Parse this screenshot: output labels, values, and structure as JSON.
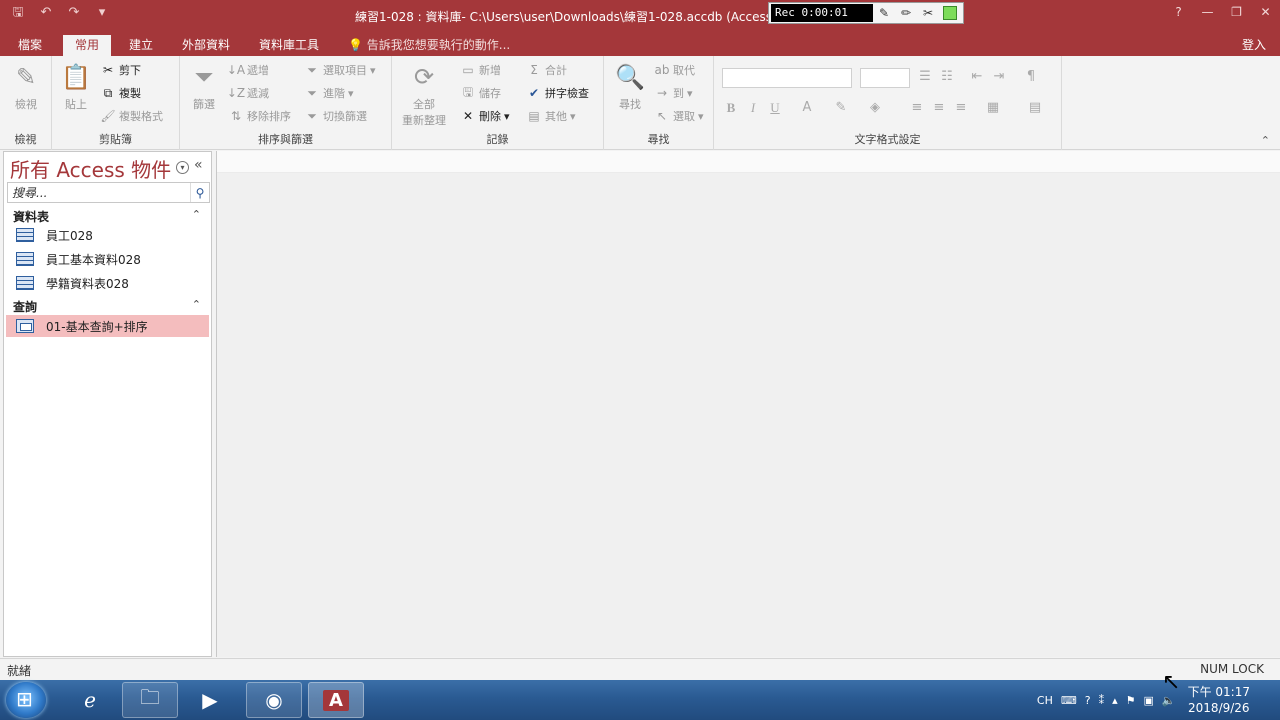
{
  "titlebar": {
    "title": "練習1-028 : 資料庫- C:\\Users\\user\\Downloads\\練習1-028.accdb (Access 20",
    "recorder_time": "Rec 0:00:01",
    "help": "?",
    "minimize": "—",
    "restore": "❐",
    "close": "✕"
  },
  "tabs": {
    "file": "檔案",
    "home": "常用",
    "create": "建立",
    "external": "外部資料",
    "dbtools": "資料庫工具",
    "tellme": "告訴我您想要執行的動作...",
    "signin": "登入"
  },
  "ribbon": {
    "views": {
      "label": "檢視",
      "view": "檢視"
    },
    "clipboard": {
      "label": "剪貼簿",
      "paste": "貼上",
      "cut": "剪下",
      "copy": "複製",
      "format_painter": "複製格式"
    },
    "sort_filter": {
      "label": "排序與篩選",
      "filter": "篩選",
      "ascending": "遞增",
      "descending": "遞減",
      "remove_sort": "移除排序",
      "selection": "選取項目",
      "advanced": "進階",
      "toggle_filter": "切換篩選"
    },
    "records": {
      "label": "記錄",
      "refresh_all_1": "全部",
      "refresh_all_2": "重新整理",
      "new": "新增",
      "save": "儲存",
      "delete": "刪除",
      "totals": "合計",
      "spelling": "拼字檢查",
      "more": "其他"
    },
    "find": {
      "label": "尋找",
      "find": "尋找",
      "replace": "取代",
      "goto": "到",
      "select": "選取"
    },
    "text_format": {
      "label": "文字格式設定",
      "bold": "B",
      "italic": "I",
      "underline": "U",
      "font_color": "A"
    }
  },
  "nav": {
    "title": "所有 Access 物件",
    "search_placeholder": "搜尋...",
    "tables_header": "資料表",
    "tables": [
      "員工028",
      "員工基本資料028",
      "學籍資料表028"
    ],
    "queries_header": "查詢",
    "queries": [
      "01-基本查詢+排序"
    ]
  },
  "status": {
    "left": "就緒",
    "right": "NUM LOCK"
  },
  "taskbar": {
    "lang": "CH",
    "time": "下午 01:17",
    "date": "2018/9/26"
  }
}
